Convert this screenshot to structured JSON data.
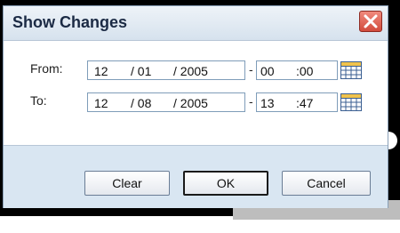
{
  "dialog": {
    "title": "Show Changes",
    "close_icon": "close-x-icon"
  },
  "from": {
    "label": "From:",
    "date": {
      "month": "12",
      "day": "/ 01",
      "year": "/ 2005"
    },
    "time": {
      "hour": "00",
      "minute": ":00"
    },
    "calendar_icon": "calendar-icon"
  },
  "to": {
    "label": "To:",
    "date": {
      "month": "12",
      "day": "/ 08",
      "year": "/ 2005"
    },
    "time": {
      "hour": "13",
      "minute": ":47"
    },
    "calendar_icon": "calendar-icon"
  },
  "separator": "-",
  "buttons": {
    "clear": "Clear",
    "ok": "OK",
    "cancel": "Cancel"
  },
  "colors": {
    "titlebar": "#d6e2ee",
    "footer": "#d9e6f2",
    "close": "#d24b3c",
    "field_border": "#7f9db9"
  }
}
